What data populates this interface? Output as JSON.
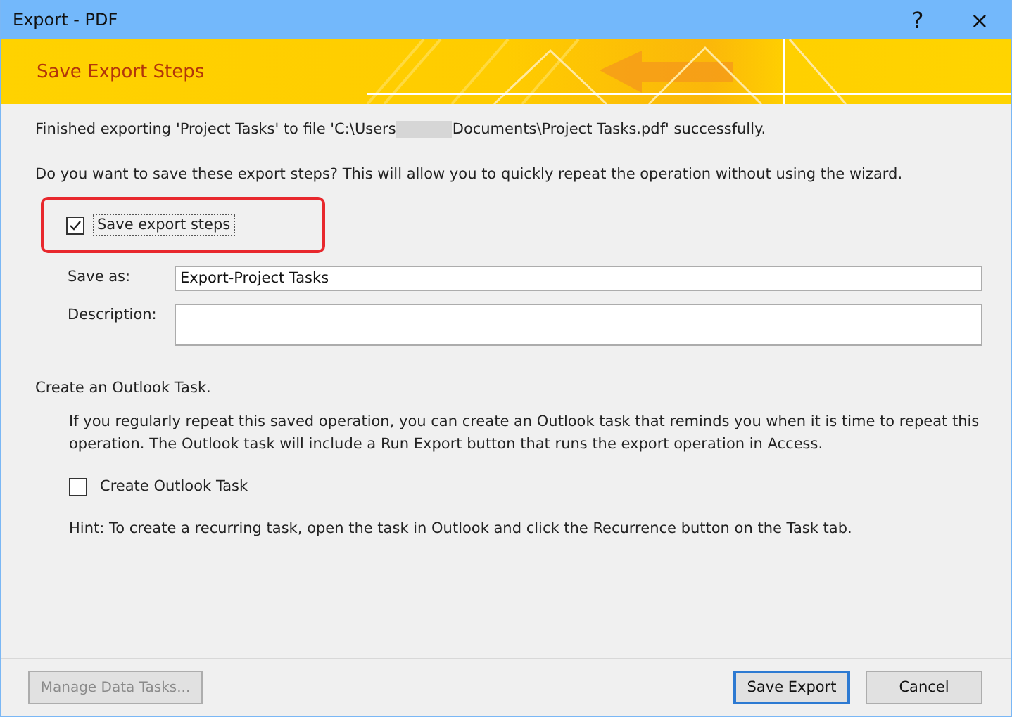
{
  "window": {
    "title": "Export - PDF",
    "help": "?",
    "close": "×"
  },
  "banner": {
    "title": "Save Export Steps"
  },
  "message": {
    "before": "Finished exporting 'Project Tasks' to file 'C:\\Users",
    "after": "Documents\\Project Tasks.pdf' successfully."
  },
  "question": "Do you want to save these export steps? This will allow you to quickly repeat the operation without using the wizard.",
  "save_steps": {
    "label": "Save export steps",
    "checked": true,
    "highlighted": true
  },
  "fields": [
    {
      "label": "Save as:",
      "value": "Export-Project Tasks",
      "kind": "single"
    },
    {
      "label": "Description:",
      "kind": "multi"
    }
  ],
  "outlook": {
    "heading": "Create an Outlook Task.",
    "text": "If you regularly repeat this saved operation, you can create an Outlook task that reminds you when it is time to repeat this operation. The Outlook task will include a Run Export button that runs the export operation in Access.",
    "checkbox": {
      "label": "Create Outlook Task",
      "checked": false
    },
    "hint": "Hint: To create a recurring task, open the task in Outlook and click the Recurrence button on the Task tab."
  },
  "buttons": [
    {
      "label": "Manage Data Tasks...",
      "disabled": true,
      "default": false
    },
    {
      "label": "Save Export",
      "disabled": false,
      "default": true
    },
    {
      "label": "Cancel",
      "disabled": false,
      "default": false
    }
  ]
}
